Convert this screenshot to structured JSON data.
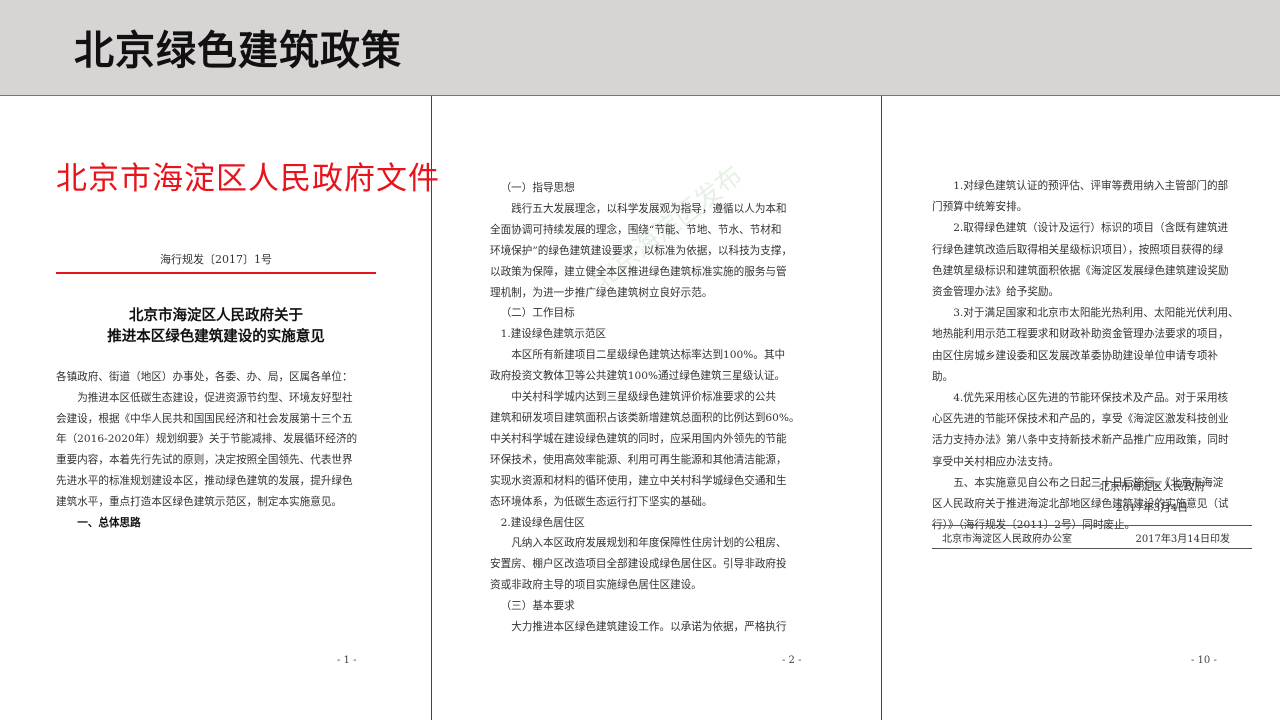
{
  "slide_title": "北京绿色建筑政策",
  "page1": {
    "red_header": "北京市海淀区人民政府文件",
    "doc_number": "海行规发〔2017〕1号",
    "doc_title_lines": [
      "北京市海淀区人民政府关于",
      "推进本区绿色建筑建设的实施意见"
    ],
    "body_lines": [
      "各镇政府、街道（地区）办事处，各委、办、局，区属各单位：",
      "为推进本区低碳生态建设，促进资源节约型、环境友好型社",
      "会建设，根据《中华人民共和国国民经济和社会发展第十三个五",
      "年（2016-2020年）规划纲要》关于节能减排、发展循环经济的",
      "重要内容，本着先行先试的原则，决定按照全国领先、代表世界",
      "先进水平的标准规划建设本区，推动绿色建筑的发展，提升绿色",
      "建筑水平，重点打造本区绿色建筑示范区，制定本实施意见。",
      "一、总体思路"
    ],
    "page_number": "- 1 -"
  },
  "page2": {
    "body_lines": [
      "（一）指导思想",
      "践行五大发展理念，以科学发展观为指导，遵循以人为本和",
      "全面协调可持续发展的理念，围绕“节能、节地、节水、节材和",
      "环境保护”的绿色建筑建设要求，以标准为依据，以科技为支撑，",
      "以政策为保障，建立健全本区推进绿色建筑标准实施的服务与管",
      "理机制，为进一步推广绿色建筑树立良好示范。",
      "（二）工作目标",
      "1.建设绿色建筑示范区",
      "本区所有新建项目二星级绿色建筑达标率达到100%。其中",
      "政府投资文教体卫等公共建筑100%通过绿色建筑三星级认证。",
      "中关村科学城内达到三星级绿色建筑评价标准要求的公共",
      "建筑和研发项目建筑面积占该类新增建筑总面积的比例达到60%。",
      "中关村科学城在建设绿色建筑的同时，应采用国内外领先的节能",
      "环保技术，使用高效率能源、利用可再生能源和其他清洁能源，",
      "实现水资源和材料的循环使用，建立中关村科学城绿色交通和生",
      "态环境体系，为低碳生态运行打下坚实的基础。",
      "2.建设绿色居住区",
      "凡纳入本区政府发展规划和年度保障性住房计划的公租房、",
      "安置房、棚户区改造项目全部建设成绿色居住区。引导非政府投",
      "资或非政府主导的项目实施绿色居住区建设。",
      "（三）基本要求",
      "大力推进本区绿色建筑建设工作。以承诺为依据，严格执行"
    ],
    "page_number": "- 2 -"
  },
  "page3": {
    "body_lines": [
      "1.对绿色建筑认证的预评估、评审等费用纳入主管部门的部",
      "门预算中统筹安排。",
      "2.取得绿色建筑（设计及运行）标识的项目（含既有建筑进",
      "行绿色建筑改造后取得相关星级标识项目），按照项目获得的绿",
      "色建筑星级标识和建筑面积依据《海淀区发展绿色建筑建设奖励",
      "资金管理办法》给予奖励。",
      "3.对于满足国家和北京市太阳能光热利用、太阳能光伏利用、",
      "地热能利用示范工程要求和财政补助资金管理办法要求的项目，",
      "由区住房城乡建设委和区发展改革委协助建设单位申请专项补",
      "助。",
      "4.优先采用核心区先进的节能环保技术及产品。对于采用核",
      "心区先进的节能环保技术和产品的，享受《海淀区激发科技创业",
      "活力支持办法》第八条中支持新技术新产品推广应用政策，同时",
      "享受中关村相应办法支持。",
      "五、本实施意见自公布之日起三十日后施行。《北京市海淀",
      "区人民政府关于推进海淀北部地区绿色建筑建设的实施意见（试",
      "行）》（海行规发〔2011〕2号）同时废止。"
    ],
    "signature": "北京市海淀区人民政府",
    "sign_date": "2017年3月4日",
    "printer_office": "北京市海淀区人民政府办公室",
    "print_date": "2017年3月14日印发",
    "page_number": "- 10 -"
  }
}
